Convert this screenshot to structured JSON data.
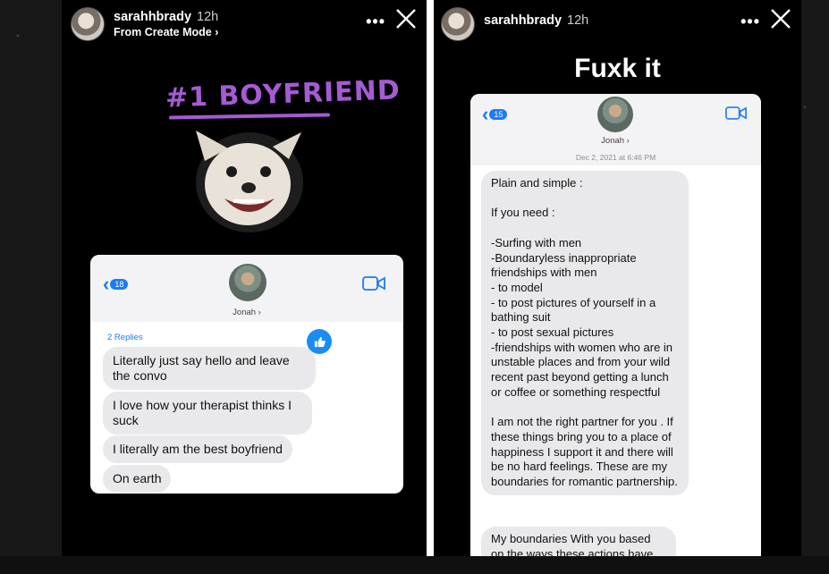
{
  "left_story": {
    "username": "sarahhbrady",
    "time": "12h",
    "subtitle": "From Create Mode ›",
    "sticker_text": "#1 BOYFRIEND",
    "card": {
      "back_count": "18",
      "contact_name": "Jonah ›",
      "replies_label": "2 Replies",
      "messages": [
        "Literally just say hello and leave the convo",
        "I love how your therapist thinks I suck",
        "I literally am the best boyfriend",
        "On earth"
      ]
    }
  },
  "right_story": {
    "username": "sarahhbrady",
    "time": "12h",
    "title": "Fuxk it",
    "card": {
      "back_count": "15",
      "contact_name": "Jonah ›",
      "date": "Dec 2, 2021 at 6:46 PM",
      "message_1": "Plain and simple :\n\nIf you need :\n\n-Surfing with men\n-Boundaryless inappropriate friendships with men\n- to model\n- to post pictures of yourself in a bathing suit\n- to post sexual pictures\n-friendships with women who are in unstable places and from your wild recent past beyond getting a lunch or coffee or something respectful\n\nI am not the right partner for you . If these things bring you to a place of happiness I support it and there will be no hard feelings. These are my boundaries for romantic partnership.",
      "message_2": "My boundaries With you based on the ways these actions have"
    }
  },
  "icons": {
    "more": "more-horizontal-icon",
    "close": "close-icon",
    "video": "video-camera-icon",
    "like": "thumbs-up-icon"
  },
  "colors": {
    "ios_blue": "#1a7cf4",
    "bubble_gray": "#e9e9eb",
    "sticker_purple": "#a45bd4"
  }
}
